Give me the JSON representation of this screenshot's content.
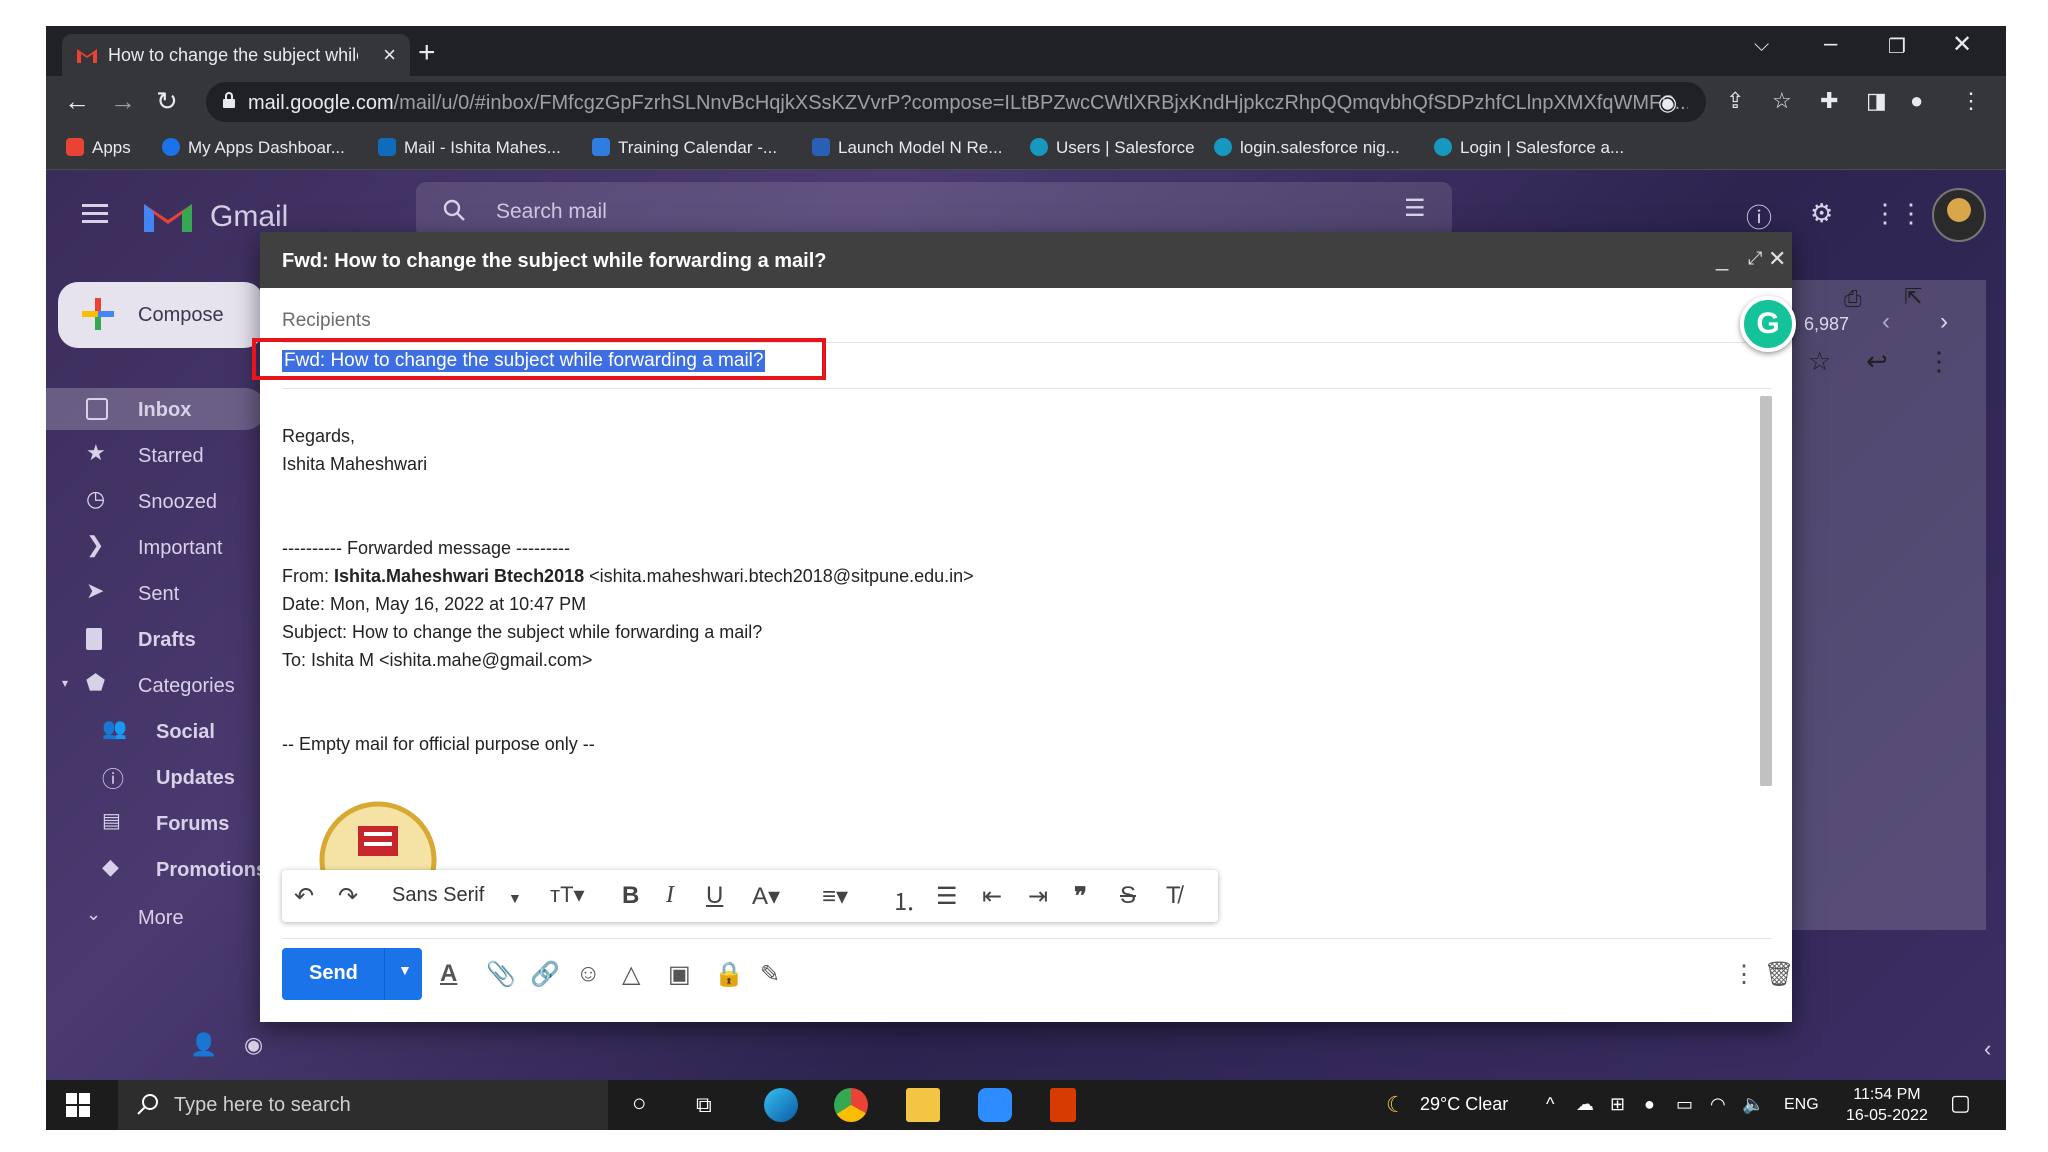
{
  "browser": {
    "tab_title": "How to change the subject while forwarding a mail?",
    "new_tab": "+",
    "url_host": "mail.google.com",
    "url_path": "/mail/u/0/#inbox/FMfcgzGpFzrhSLNnvBcHqjkXSsKZVvrP?compose=ILtBPZwcCWtlXRBjxKndHjpkczRhpQQmqvbhQfSDPzhfCLlnpXMXfqWMFS...",
    "bookmarks": [
      {
        "label": "Apps",
        "color": "#ea4335"
      },
      {
        "label": "My Apps Dashboar...",
        "color": "#1a73e8"
      },
      {
        "label": "Mail - Ishita Mahes...",
        "color": "#0f6cbd"
      },
      {
        "label": "Training Calendar -...",
        "color": "#2f7de1"
      },
      {
        "label": "Launch Model N Re...",
        "color": "#2a5fb6"
      },
      {
        "label": "Users | Salesforce",
        "color": "#1798c1"
      },
      {
        "label": "login.salesforce nig...",
        "color": "#1798c1"
      },
      {
        "label": "Login | Salesforce a...",
        "color": "#1798c1"
      }
    ]
  },
  "gmail": {
    "brand": "Gmail",
    "search_placeholder": "Search mail",
    "compose_label": "Compose",
    "count_text": "6,987",
    "nav": [
      {
        "label": "Inbox",
        "icon": "inbox-icon"
      },
      {
        "label": "Starred",
        "icon": "star-icon"
      },
      {
        "label": "Snoozed",
        "icon": "clock-icon"
      },
      {
        "label": "Important",
        "icon": "important-icon"
      },
      {
        "label": "Sent",
        "icon": "send-icon"
      },
      {
        "label": "Drafts",
        "icon": "draft-icon"
      },
      {
        "label": "Categories",
        "icon": "label-icon"
      }
    ],
    "categories": [
      {
        "label": "Social",
        "icon": "people-icon"
      },
      {
        "label": "Updates",
        "icon": "info-icon"
      },
      {
        "label": "Forums",
        "icon": "forum-icon"
      },
      {
        "label": "Promotions",
        "icon": "tag-icon"
      }
    ],
    "more_label": "More"
  },
  "compose": {
    "title": "Fwd: How to change the subject while forwarding a mail?",
    "recipients_placeholder": "Recipients",
    "subject": "Fwd: How to change the subject while forwarding a mail?",
    "regards": "Regards,",
    "signature_name": "Ishita Maheshwari",
    "fwd_header": "---------- Forwarded message ---------",
    "from_label": "From: ",
    "from_name": "Ishita.Maheshwari Btech2018",
    "from_email": " <ishita.maheshwari.btech2018@sitpune.edu.in>",
    "date_line": "Date: Mon, May 16, 2022 at 10:47 PM",
    "subject_line": "Subject: How to change the subject while forwarding a mail?",
    "to_line": "To: Ishita M <ishita.mahe@gmail.com>",
    "footer_note": "-- Empty mail for official purpose only --",
    "font_name": "Sans Serif",
    "send_label": "Send"
  },
  "taskbar": {
    "search_placeholder": "Type here to search",
    "weather": "29°C  Clear",
    "language": "ENG",
    "time": "11:54 PM",
    "date": "16-05-2022"
  },
  "colors": {
    "accent": "#1a73e8",
    "highlight_box": "#e8141c",
    "selection": "#3d6ee2",
    "grammarly": "#15c39a"
  }
}
